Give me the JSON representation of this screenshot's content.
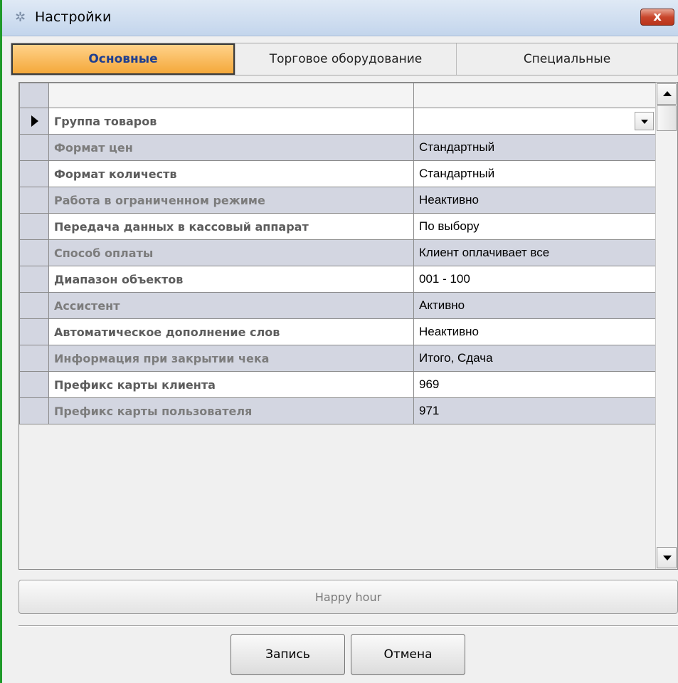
{
  "window": {
    "title": "Настройки",
    "close_label": "x"
  },
  "tabs": [
    {
      "label": "Основные",
      "active": true
    },
    {
      "label": "Торговое оборудование",
      "active": false
    },
    {
      "label": "Специальные",
      "active": false
    }
  ],
  "grid": {
    "rows": [
      {
        "name": "Группа товаров",
        "value": ""
      },
      {
        "name": "Формат  цен",
        "value": "Стандартный"
      },
      {
        "name": "Формат количеств",
        "value": "Стандартный"
      },
      {
        "name": "Работа в ограниченном режиме",
        "value": "Неактивно"
      },
      {
        "name": "Передача данных в кассовый аппарат",
        "value": "По выбору"
      },
      {
        "name": "Способ оплаты",
        "value": "Клиент оплачивает все"
      },
      {
        "name": "Диапазон объектов",
        "value": "001 - 100"
      },
      {
        "name": "Ассистент",
        "value": "Активно"
      },
      {
        "name": "Автоматическое дополнение слов",
        "value": "Неактивно"
      },
      {
        "name": "Информация при закрытии чека",
        "value": "Итого, Сдача"
      },
      {
        "name": "Префикс карты клиента",
        "value": "969"
      },
      {
        "name": "Префикс карты пользователя",
        "value": "971"
      }
    ]
  },
  "buttons": {
    "happy_hour": "Happy hour",
    "save": "Запись",
    "cancel": "Отмена"
  },
  "colors": {
    "tab_active": "#f4a83a",
    "row_alt": "#d3d6e1",
    "window_border": "#1f9a2a"
  },
  "icons": {
    "title": "settings-gear-icon",
    "row_pointer": "row-pointer-icon"
  }
}
